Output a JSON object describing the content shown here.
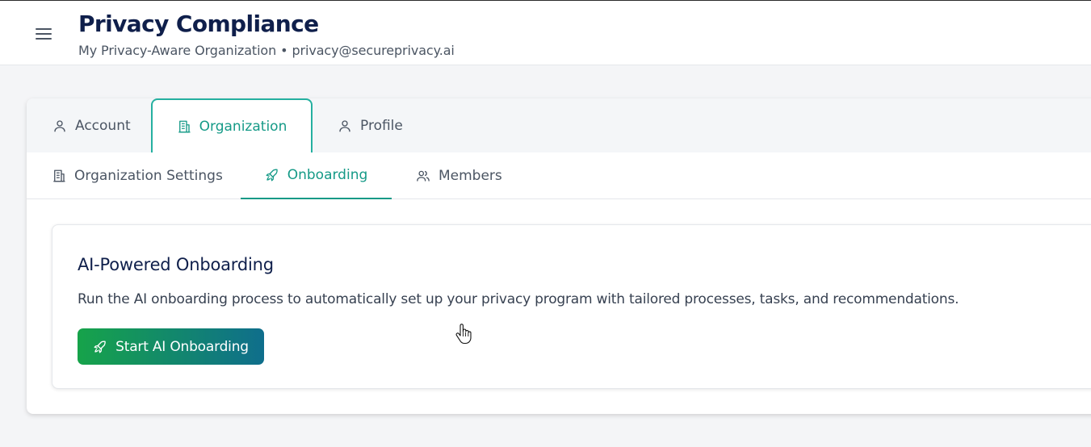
{
  "header": {
    "title": "Privacy Compliance",
    "subtitle": "My Privacy-Aware Organization • privacy@secureprivacy.ai",
    "menu_icon": "hamburger-menu-icon"
  },
  "tabs": [
    {
      "label": "Account",
      "icon": "user-icon",
      "active": false
    },
    {
      "label": "Organization",
      "icon": "building-icon",
      "active": true
    },
    {
      "label": "Profile",
      "icon": "user-icon",
      "active": false
    }
  ],
  "subtabs": [
    {
      "label": "Organization Settings",
      "icon": "building-icon",
      "active": false
    },
    {
      "label": "Onboarding",
      "icon": "rocket-icon",
      "active": true
    },
    {
      "label": "Members",
      "icon": "users-icon",
      "active": false
    }
  ],
  "onboarding": {
    "title": "AI-Powered Onboarding",
    "description": "Run the AI onboarding process to automatically set up your privacy program with tailored processes, tasks, and recommendations.",
    "button_label": "Start AI Onboarding",
    "button_icon": "rocket-icon"
  },
  "colors": {
    "accent": "#159a87",
    "title": "#0f1f4b",
    "button_gradient_start": "#16a34a",
    "button_gradient_end": "#0f6e8c"
  }
}
